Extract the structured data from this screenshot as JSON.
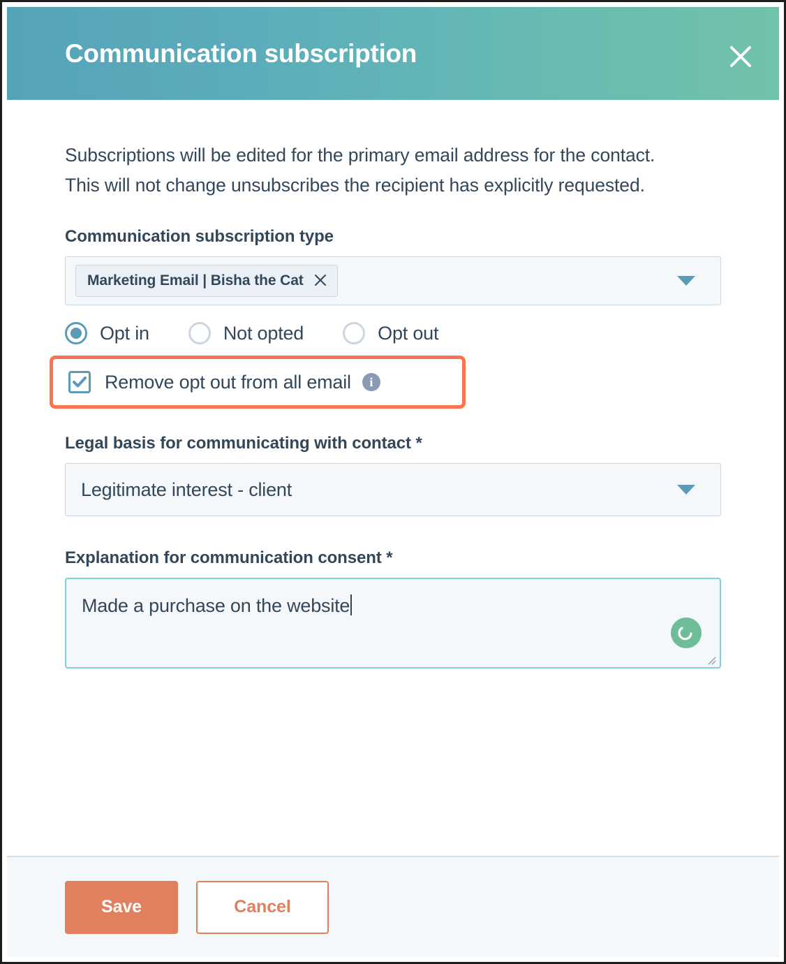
{
  "modal": {
    "title": "Communication subscription",
    "close_label": "Close",
    "close_icon": "close-icon",
    "header_gradient_from": "#55a3b9",
    "header_gradient_to": "#71c2ab"
  },
  "body": {
    "intro_line_1": "Subscriptions will be edited for the primary email address for the contact.",
    "intro_line_2": "This will not change unsubscribes the recipient has explicitly requested."
  },
  "subscription_type": {
    "label": "Communication subscription type",
    "tokens": [
      {
        "label": "Marketing Email | Bisha the Cat",
        "remove_icon": "close-icon"
      }
    ],
    "dropdown_icon": "chevron-down-icon"
  },
  "opt_status": {
    "options": [
      {
        "label": "Opt in",
        "selected": true
      },
      {
        "label": "Not opted",
        "selected": false
      },
      {
        "label": "Opt out",
        "selected": false
      }
    ]
  },
  "remove_opt_out": {
    "label": "Remove opt out from all email",
    "checked": true,
    "info_icon": "info-icon",
    "info_glyph": "i",
    "highlight_color": "#fb7452",
    "accent_color": "#5b9bb8"
  },
  "legal_basis": {
    "label": "Legal basis for communicating with contact *",
    "value": "Legitimate interest - client",
    "dropdown_icon": "chevron-down-icon"
  },
  "explanation": {
    "label": "Explanation for communication consent *",
    "value": "Made a purchase on the website",
    "placeholder": "",
    "focus_border_color": "#7fd1de",
    "status_icon": "loading-spinner-icon",
    "status_color": "#6fbd98"
  },
  "footer": {
    "save_label": "Save",
    "cancel_label": "Cancel",
    "primary_color": "#e0805f"
  }
}
